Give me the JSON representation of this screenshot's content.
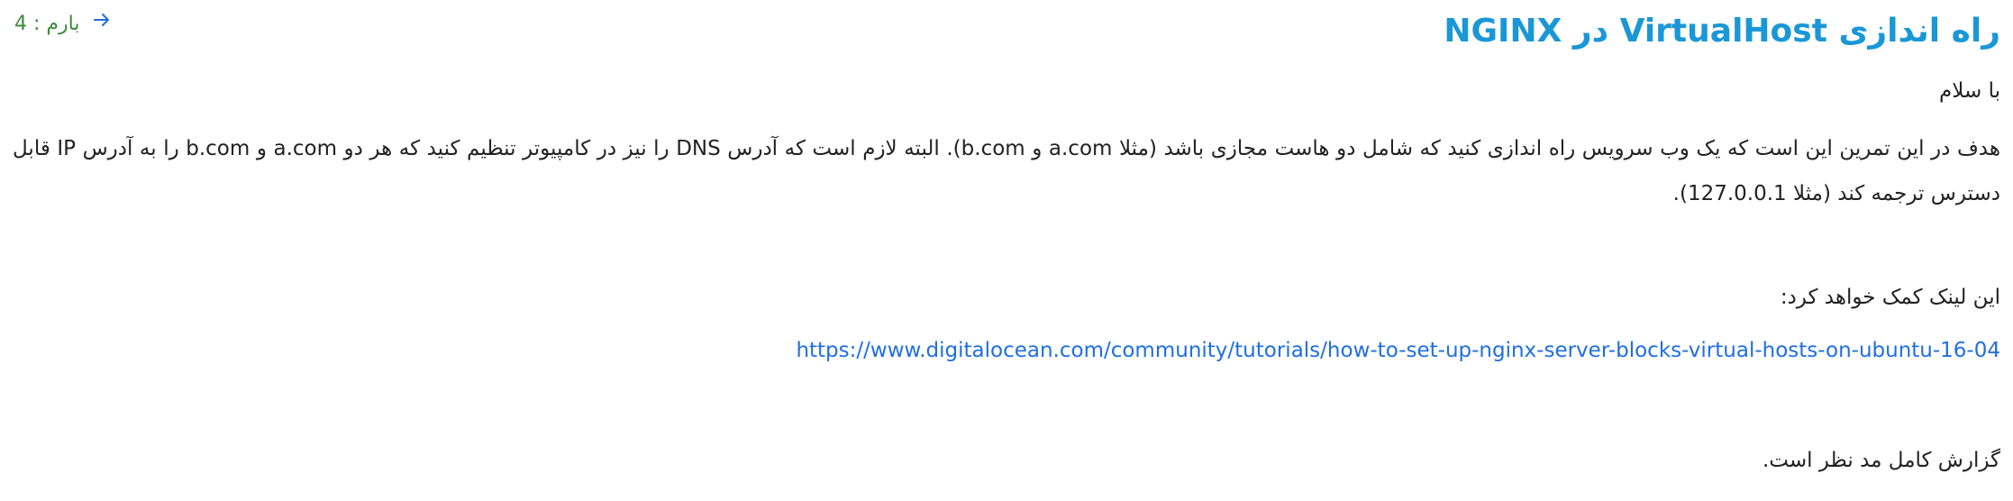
{
  "header": {
    "title": "راه اندازی VirtualHost در NGINX",
    "score_text": "بارم : 4",
    "back_icon": "arrow-right-icon"
  },
  "body": {
    "greeting": "با سلام",
    "paragraph": "هدف در این تمرین این است که یک وب سرویس راه اندازی کنید که شامل دو هاست مجازی باشد (مثلا a.com و b.com). البته لازم است که آدرس DNS را نیز در کامپیوتر تنظیم کنید که هر دو a.com و b.com را به آدرس IP قابل دسترس ترجمه کند (مثلا 127.0.0.1).",
    "link_intro": "این لینک کمک خواهد کرد:",
    "link_url": "https://www.digitalocean.com/community/tutorials/how-to-set-up-nginx-server-blocks-virtual-hosts-on-ubuntu-16-04",
    "report_note": "گزارش کامل مد نظر است."
  },
  "colors": {
    "title": "#1a97d6",
    "score": "#3c8a3c",
    "link": "#1f6fe0",
    "icon": "#1f6fe0",
    "text": "#222222"
  }
}
